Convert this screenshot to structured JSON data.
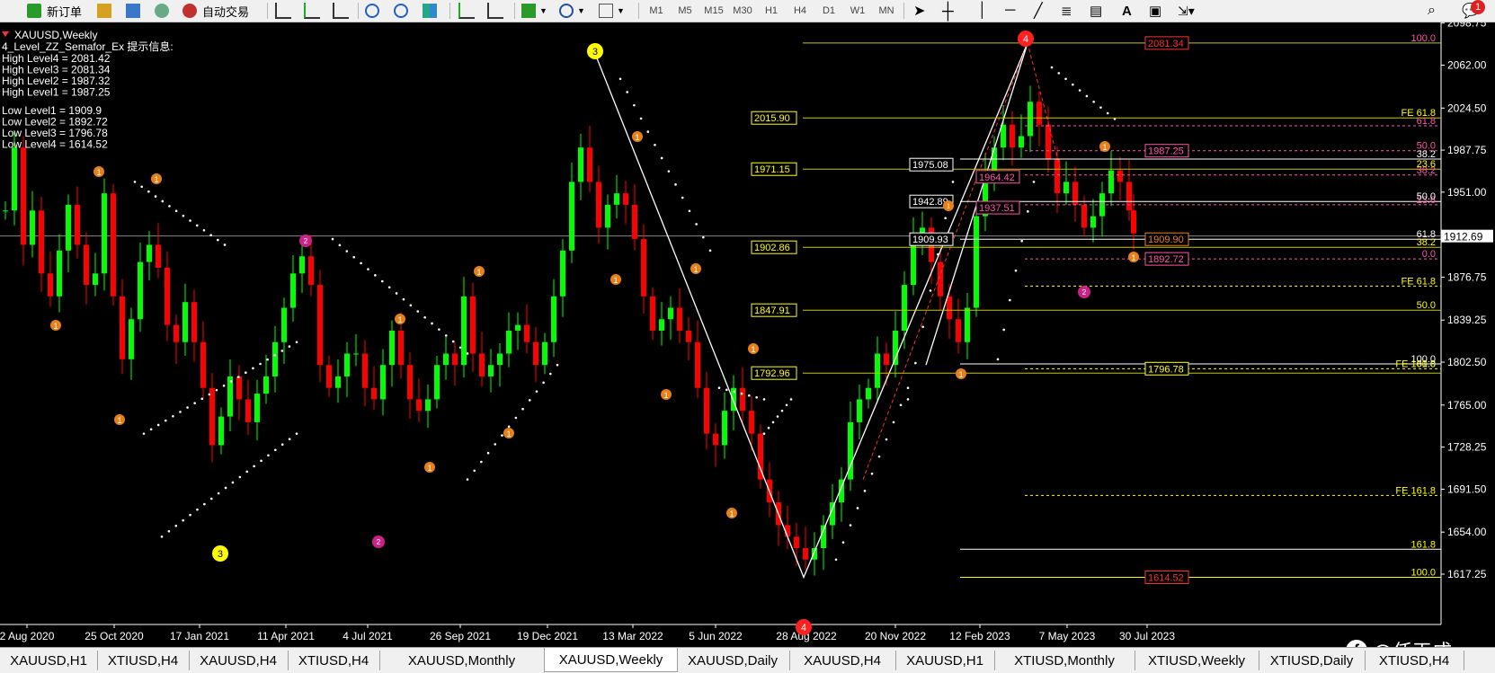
{
  "toolbar": {
    "new_order_label": "新订单",
    "autotrade_label": "自动交易",
    "timeframes": [
      "M1",
      "M5",
      "M15",
      "M30",
      "H1",
      "H4",
      "D1",
      "W1",
      "MN"
    ],
    "alert_count": "1"
  },
  "chart": {
    "symbol_title": "XAUUSD,Weekly",
    "indicator_title": "4_Level_ZZ_Semafor_Ex 提示信息:",
    "levels_high": [
      "High Level4 = 2081.42",
      "High Level3 = 2081.34",
      "High Level2 = 1987.32",
      "High Level1 = 1987.25"
    ],
    "levels_low": [
      "Low Level1 = 1909.9",
      "Low Level2 = 1892.72",
      "Low Level3 = 1796.78",
      "Low Level4 = 1614.52"
    ],
    "current_price": "1912.69",
    "price_axis": [
      "2098.75",
      "2062.00",
      "2024.50",
      "1987.75",
      "1951.00",
      "1876.75",
      "1839.25",
      "1802.50",
      "1765.00",
      "1728.25",
      "1691.50",
      "1654.00",
      "1617.25"
    ],
    "time_axis": [
      "2 Aug 2020",
      "25 Oct 2020",
      "17 Jan 2021",
      "11 Apr 2021",
      "4 Jul 2021",
      "26 Sep 2021",
      "19 Dec 2021",
      "13 Mar 2022",
      "5 Jun 2022",
      "28 Aug 2022",
      "20 Nov 2022",
      "12 Feb 2023",
      "7 May 2023",
      "30 Jul 2023"
    ],
    "left_price_boxes": [
      "2015.90",
      "1971.15",
      "1902.86",
      "1847.91",
      "1792.96"
    ],
    "mid_price_boxes": [
      "1975.08",
      "1942.89",
      "1909.93"
    ],
    "pink_boxes": [
      "1964.42",
      "1937.51"
    ],
    "right_red_boxes": [
      "2081.34",
      "1614.52"
    ],
    "right_pink_boxes": [
      "1987.25",
      "1892.72"
    ],
    "right_boxes_other": [
      "1909.90",
      "1796.78"
    ],
    "fib_labels_pink": [
      "100.0",
      "61.8",
      "50.0",
      "38.2",
      "23.6",
      "0.0"
    ],
    "fib_labels_white": [
      "38.2",
      "50.0",
      "61.8",
      "100.0",
      "61.8"
    ],
    "fe_labels": [
      "FE 61.8",
      "FE 61.8",
      "FE 100.0",
      "FE 161.8",
      "161.8",
      "100.0",
      "50.0",
      "38.2",
      "23.6"
    ],
    "swing_markers": [
      "3",
      "3",
      "4",
      "4",
      "2",
      "2",
      "2",
      "1"
    ]
  },
  "tabs": [
    "XAUUSD,H1",
    "XTIUSD,H4",
    "XAUUSD,H4",
    "XTIUSD,H4",
    "XAUUSD,Monthly",
    "XAUUSD,Weekly",
    "XAUUSD,Daily",
    "XAUUSD,H4",
    "XAUUSD,H1",
    "XTIUSD,Monthly",
    "XTIUSD,Weekly",
    "XTIUSD,Daily",
    "XTIUSD,H4"
  ],
  "active_tab": "XAUUSD,Weekly",
  "watermark": "@任天成",
  "colors": {
    "up": "#00ff00",
    "down": "#ff0000",
    "fib_yellow": "#ffff00",
    "fib_pink": "#ff55aa",
    "marker_orange": "#e8801a"
  }
}
